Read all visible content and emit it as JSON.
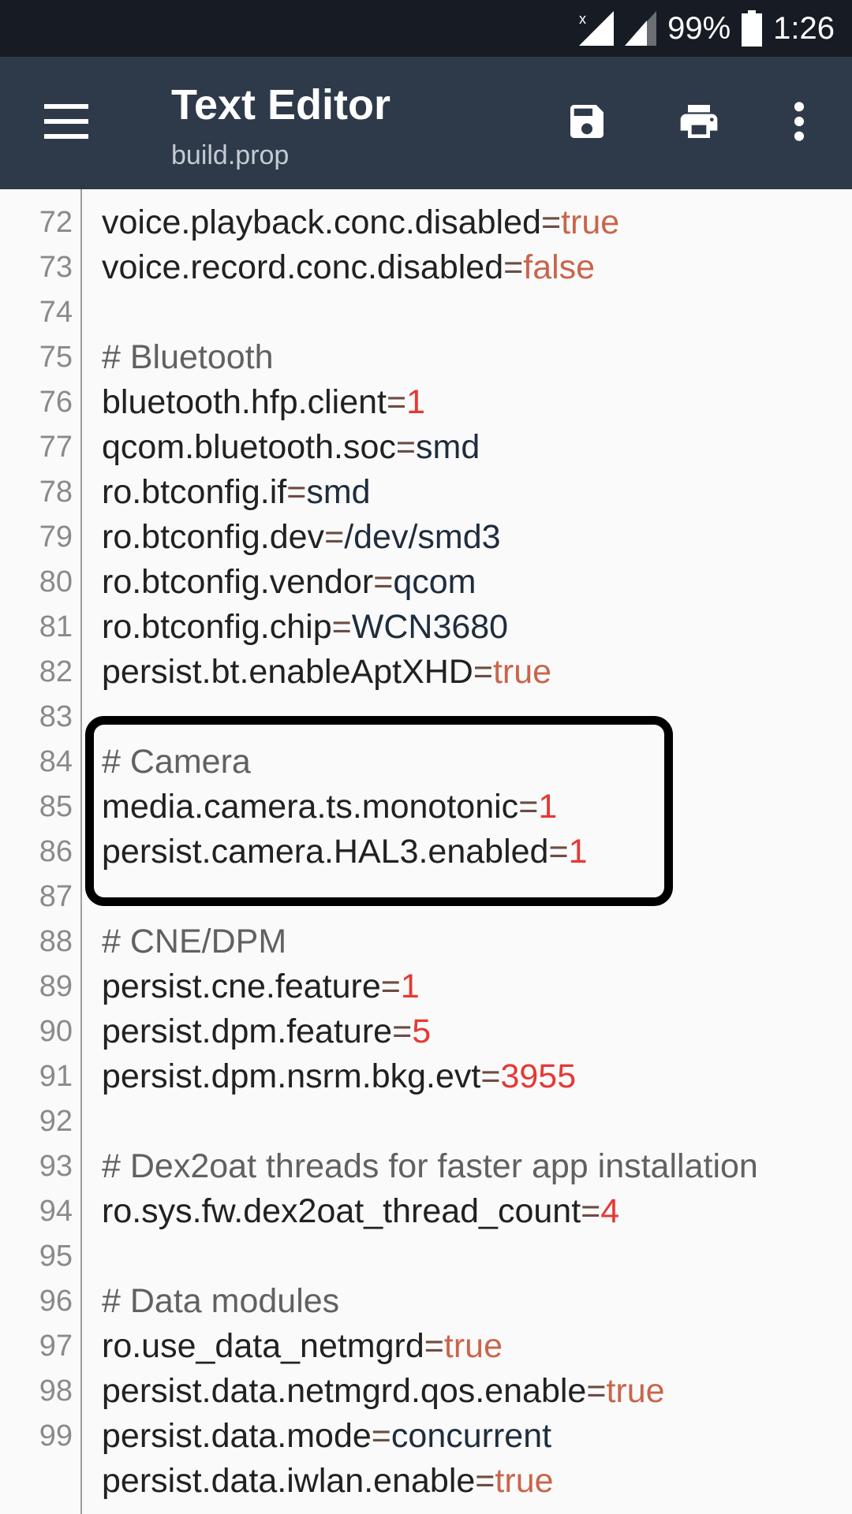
{
  "status_bar": {
    "battery": "99%",
    "time": "1:26",
    "icons": [
      "signal-no-data-icon",
      "signal-icon",
      "battery-icon"
    ]
  },
  "toolbar": {
    "title": "Text Editor",
    "subtitle": "build.prop",
    "icons": [
      "menu-icon",
      "save-icon",
      "print-icon",
      "more-vert-icon"
    ]
  },
  "colors": {
    "toolbar": "#2e3a4a",
    "status_bar": "#171c24",
    "bool": "#c9654b",
    "number": "#e53935",
    "string": "#1f2d3d",
    "equals": "#6d4c41",
    "comment": "#616161"
  },
  "lines": [
    {
      "num": "",
      "type": "blank"
    },
    {
      "num": "72",
      "type": "kv",
      "key": "voice.playback.conc.disabled",
      "value": "true",
      "vtype": "bool"
    },
    {
      "num": "73",
      "type": "kv",
      "key": "voice.record.conc.disabled",
      "value": "false",
      "vtype": "bool"
    },
    {
      "num": "74",
      "type": "blank"
    },
    {
      "num": "75",
      "type": "comment",
      "text": "# Bluetooth"
    },
    {
      "num": "76",
      "type": "kv",
      "key": "bluetooth.hfp.client",
      "value": "1",
      "vtype": "num"
    },
    {
      "num": "77",
      "type": "kv",
      "key": "qcom.bluetooth.soc",
      "value": "smd",
      "vtype": "str"
    },
    {
      "num": "78",
      "type": "kv",
      "key": "ro.btconfig.if",
      "value": "smd",
      "vtype": "str"
    },
    {
      "num": "79",
      "type": "kv",
      "key": "ro.btconfig.dev",
      "value": "/dev/smd3",
      "vtype": "str"
    },
    {
      "num": "80",
      "type": "kv",
      "key": "ro.btconfig.vendor",
      "value": "qcom",
      "vtype": "str"
    },
    {
      "num": "81",
      "type": "kv",
      "key": "ro.btconfig.chip",
      "value": "WCN3680",
      "vtype": "str"
    },
    {
      "num": "82",
      "type": "kv",
      "key": "persist.bt.enableAptXHD",
      "value": "true",
      "vtype": "bool"
    },
    {
      "num": "83",
      "type": "blank"
    },
    {
      "num": "84",
      "type": "comment",
      "text": "# Camera"
    },
    {
      "num": "85",
      "type": "kv",
      "key": "media.camera.ts.monotonic",
      "value": "1",
      "vtype": "num"
    },
    {
      "num": "86",
      "type": "kv",
      "key": "persist.camera.HAL3.enabled",
      "value": "1",
      "vtype": "num"
    },
    {
      "num": "87",
      "type": "blank"
    },
    {
      "num": "88",
      "type": "comment",
      "text": "# CNE/DPM"
    },
    {
      "num": "89",
      "type": "kv",
      "key": "persist.cne.feature",
      "value": "1",
      "vtype": "num"
    },
    {
      "num": "90",
      "type": "kv",
      "key": "persist.dpm.feature",
      "value": "5",
      "vtype": "num"
    },
    {
      "num": "91",
      "type": "kv",
      "key": "persist.dpm.nsrm.bkg.evt",
      "value": "3955",
      "vtype": "num"
    },
    {
      "num": "92",
      "type": "blank"
    },
    {
      "num": "93",
      "type": "comment",
      "text": "# Dex2oat threads for faster app installation"
    },
    {
      "num": "94",
      "type": "kv",
      "key": "ro.sys.fw.dex2oat_thread_count",
      "value": "4",
      "vtype": "num"
    },
    {
      "num": "95",
      "type": "blank"
    },
    {
      "num": "96",
      "type": "comment",
      "text": "# Data modules"
    },
    {
      "num": "97",
      "type": "kv",
      "key": "ro.use_data_netmgrd",
      "value": "true",
      "vtype": "bool"
    },
    {
      "num": "98",
      "type": "kv",
      "key": "persist.data.netmgrd.qos.enable",
      "value": "true",
      "vtype": "bool"
    },
    {
      "num": "99",
      "type": "kv",
      "key": "persist.data.mode",
      "value": "concurrent",
      "vtype": "str"
    },
    {
      "num": "",
      "type": "kv",
      "key": "persist.data.iwlan.enable",
      "value": "true",
      "vtype": "bool"
    }
  ]
}
